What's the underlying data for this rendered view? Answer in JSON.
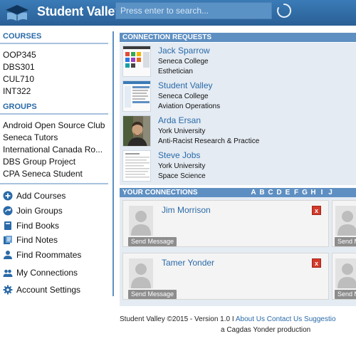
{
  "header": {
    "logo_text": "Student Valley",
    "search_placeholder": "Press enter to search..."
  },
  "sidebar": {
    "courses_title": "COURSES",
    "courses": [
      "OOP345",
      "DBS301",
      "CUL710",
      "INT322"
    ],
    "groups_title": "GROUPS",
    "groups": [
      "Android Open Source Club",
      "Seneca Tutors",
      "International Canada Ro...",
      "DBS Group Project",
      "CPA Seneca Student"
    ],
    "actions": [
      {
        "label": "Add Courses",
        "icon": "plus-circle-icon"
      },
      {
        "label": "Join Groups",
        "icon": "arrow-circle-icon"
      },
      {
        "label": "Find Books",
        "icon": "book-icon"
      },
      {
        "label": "Find Notes",
        "icon": "notes-icon"
      },
      {
        "label": "Find Roommates",
        "icon": "person-icon"
      },
      {
        "label": "My Connections",
        "icon": "people-icon"
      },
      {
        "label": "Account Settings",
        "icon": "gear-icon"
      }
    ]
  },
  "requests": {
    "title": "CONNECTION REQUESTS",
    "items": [
      {
        "name": "Jack Sparrow",
        "school": "Seneca College",
        "program": "Esthetician"
      },
      {
        "name": "Student Valley",
        "school": "Seneca College",
        "program": "Aviation Operations"
      },
      {
        "name": "Arda Ersan",
        "school": "York University",
        "program": "Anti-Racist Research & Practice"
      },
      {
        "name": "Steve Jobs",
        "school": "York University",
        "program": "Space Science"
      }
    ]
  },
  "connections": {
    "title": "YOUR CONNECTIONS",
    "letters": [
      "A",
      "B",
      "C",
      "D",
      "E",
      "F",
      "G",
      "H",
      "I",
      "J"
    ],
    "send_label": "Send Message",
    "send_label_partial": "Send M",
    "remove_label": "x",
    "items": [
      {
        "name": "Jim Morrison"
      },
      {
        "name": "Tamer Yonder"
      }
    ]
  },
  "footer": {
    "copyright": "Student Valley ©2015 - Version 1.0 I",
    "links": [
      "About Us",
      "Contact Us",
      "Suggestio"
    ],
    "credit": "a Cagdas Yonder production"
  },
  "colors": {
    "header": "#2a5f95",
    "accent": "#2a6aa8",
    "panel_header": "#5e8fc2",
    "panel_body": "#e4ebf3",
    "remove": "#d23a2a"
  }
}
